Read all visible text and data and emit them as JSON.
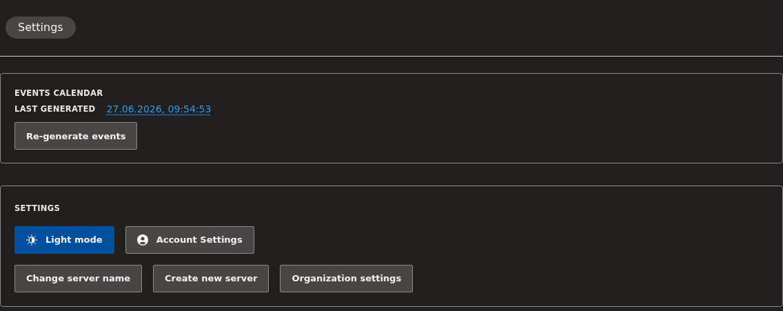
{
  "page": {
    "title": "Settings"
  },
  "events_calendar": {
    "heading": "EVENTS CALENDAR",
    "last_generated_label": "LAST GENERATED",
    "last_generated_value": "27.06.2026, 09:54:53",
    "buttons": [
      {
        "label": "Re-generate events",
        "kind": "plain"
      }
    ]
  },
  "settings": {
    "heading": "SETTINGS",
    "button_rows": [
      [
        {
          "label": "Light mode",
          "kind": "theme"
        },
        {
          "label": "Account Settings",
          "kind": "account"
        }
      ],
      [
        {
          "label": "Change server name",
          "kind": "plain"
        },
        {
          "label": "Create new server",
          "kind": "plain"
        },
        {
          "label": "Organization settings",
          "kind": "plain"
        }
      ]
    ]
  }
}
